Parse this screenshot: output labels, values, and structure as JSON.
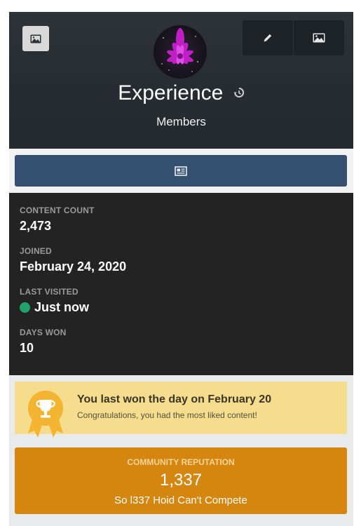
{
  "profile": {
    "name": "Experience",
    "group": "Members"
  },
  "header": {
    "cover_photo_icon": "image-icon",
    "edit_icon": "pencil-icon",
    "change_cover_icon": "image-icon",
    "history_icon": "history-icon"
  },
  "action_bar": {
    "icon": "newspaper-icon"
  },
  "stats": [
    {
      "label": "CONTENT COUNT",
      "value": "2,473"
    },
    {
      "label": "JOINED",
      "value": "February 24, 2020"
    },
    {
      "label": "LAST VISITED",
      "value": "Just now",
      "status": "online"
    },
    {
      "label": "DAYS WON",
      "value": "10"
    }
  ],
  "day_won": {
    "title": "You last won the day on February 20",
    "subtitle": "Congratulations, you had the most liked content!",
    "icon": "trophy-icon"
  },
  "reputation": {
    "label": "COMMUNITY REPUTATION",
    "value": "1,337",
    "title": "So l337 Hoid Can't Compete"
  },
  "colors": {
    "header_bg": "#262c31",
    "action_button": "#35506e",
    "stats_bg": "#232323",
    "online": "#1fa36a",
    "day_won_bg": "#f6dc8d",
    "trophy": "#f2b431",
    "reputation_bg": "#d4860f"
  }
}
